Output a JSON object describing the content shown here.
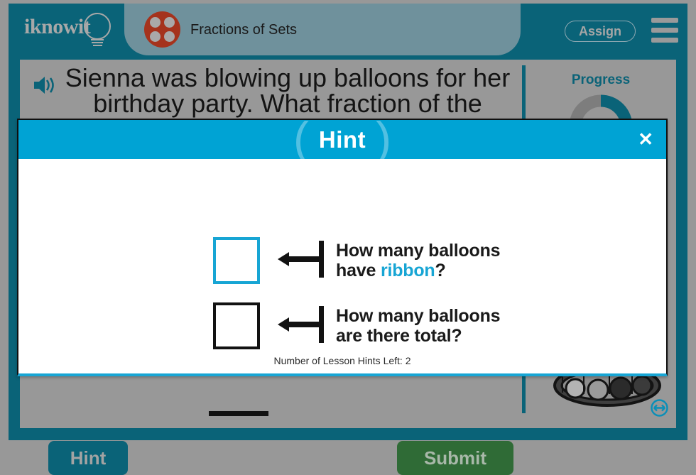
{
  "header": {
    "logo_text": "iknowit",
    "logo_icon": "lightbulb-icon",
    "lesson_icon": "four-dot-circle-icon",
    "lesson_title": "Fractions of Sets",
    "assign_label": "Assign",
    "menu_icon": "hamburger-menu-icon"
  },
  "question": {
    "speaker_icon": "audio-speaker-icon",
    "text": "Sienna was blowing up balloons for her birthday party. What fraction of the"
  },
  "right_rail": {
    "progress_label": "Progress",
    "progress_percent": 50,
    "character_icon": "cartoon-tank-character",
    "resize_icon": "resize-horizontal-icon"
  },
  "actions": {
    "hint_label": "Hint",
    "submit_label": "Submit"
  },
  "hint_modal": {
    "title": "Hint",
    "close_icon": "close-x-icon",
    "left_paren": "(",
    "right_paren": ")",
    "numerator": {
      "box_color": "#17a5d4",
      "label_line1": "How many balloons",
      "label_line2_prefix": "have ",
      "label_line2_keyword": "ribbon",
      "label_line2_suffix": "?"
    },
    "denominator": {
      "box_color": "#121212",
      "label_line1": "How many balloons",
      "label_line2": "are there total?"
    },
    "hints_left_text": "Number of Lesson Hints Left: 2"
  },
  "colors": {
    "teal": "#0a6378",
    "cyan": "#00a3d4",
    "accent_cyan": "#17a5d4",
    "gray_bg": "#989898",
    "green": "#2f6b36",
    "red": "#a5331d"
  }
}
